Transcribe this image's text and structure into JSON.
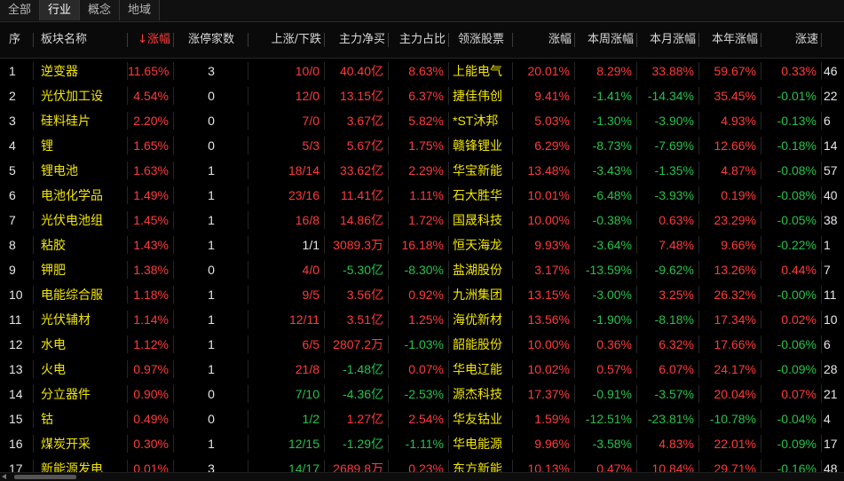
{
  "tabs": [
    "全部",
    "行业",
    "概念",
    "地域"
  ],
  "active_tab": 1,
  "headers": {
    "seq": "序",
    "name": "板块名称",
    "chg": "涨幅",
    "limit": "涨停家数",
    "updown": "上涨/下跌",
    "netbuy": "主力净买",
    "ratio": "主力占比",
    "leader": "领涨股票",
    "lchg": "涨幅",
    "week": "本周涨幅",
    "month": "本月涨幅",
    "year": "本年涨幅",
    "speed": "涨速"
  },
  "sort_arrow": "↓",
  "colors": {
    "up": "#ff3b3b",
    "down": "#27c24c",
    "name": "#f2e600"
  },
  "rows": [
    {
      "seq": "1",
      "name": "逆变器",
      "chg": "11.65%",
      "limit": "3",
      "updown": "10/0",
      "netbuy": "40.40亿",
      "ratio": "8.63%",
      "leader": "上能电气",
      "lchg": "20.01%",
      "week": "8.29%",
      "month": "33.88%",
      "year": "59.67%",
      "speed": "0.33%",
      "extra": "46"
    },
    {
      "seq": "2",
      "name": "光伏加工设",
      "chg": "4.54%",
      "limit": "0",
      "updown": "12/0",
      "netbuy": "13.15亿",
      "ratio": "6.37%",
      "leader": "捷佳伟创",
      "lchg": "9.41%",
      "week": "-1.41%",
      "month": "-14.34%",
      "year": "35.45%",
      "speed": "-0.01%",
      "extra": "22"
    },
    {
      "seq": "3",
      "name": "硅料硅片",
      "chg": "2.20%",
      "limit": "0",
      "updown": "7/0",
      "netbuy": "3.67亿",
      "ratio": "5.82%",
      "leader": "*ST沐邦",
      "lchg": "5.03%",
      "week": "-1.30%",
      "month": "-3.90%",
      "year": "4.93%",
      "speed": "-0.13%",
      "extra": "6"
    },
    {
      "seq": "4",
      "name": "锂",
      "chg": "1.65%",
      "limit": "0",
      "updown": "5/3",
      "netbuy": "5.67亿",
      "ratio": "1.75%",
      "leader": "赣锋锂业",
      "lchg": "6.29%",
      "week": "-8.73%",
      "month": "-7.69%",
      "year": "12.66%",
      "speed": "-0.18%",
      "extra": "14"
    },
    {
      "seq": "5",
      "name": "锂电池",
      "chg": "1.63%",
      "limit": "1",
      "updown": "18/14",
      "netbuy": "33.62亿",
      "ratio": "2.29%",
      "leader": "华宝新能",
      "lchg": "13.48%",
      "week": "-3.43%",
      "month": "-1.35%",
      "year": "4.87%",
      "speed": "-0.08%",
      "extra": "57"
    },
    {
      "seq": "6",
      "name": "电池化学品",
      "chg": "1.49%",
      "limit": "1",
      "updown": "23/16",
      "netbuy": "11.41亿",
      "ratio": "1.11%",
      "leader": "石大胜华",
      "lchg": "10.01%",
      "week": "-6.48%",
      "month": "-3.93%",
      "year": "0.19%",
      "speed": "-0.08%",
      "extra": "40"
    },
    {
      "seq": "7",
      "name": "光伏电池组",
      "chg": "1.45%",
      "limit": "1",
      "updown": "16/8",
      "netbuy": "14.86亿",
      "ratio": "1.72%",
      "leader": "国晟科技",
      "lchg": "10.00%",
      "week": "-0.38%",
      "month": "0.63%",
      "year": "23.29%",
      "speed": "-0.05%",
      "extra": "38"
    },
    {
      "seq": "8",
      "name": "粘胶",
      "chg": "1.43%",
      "limit": "1",
      "updown": "1/1",
      "netbuy": "3089.3万",
      "ratio": "16.18%",
      "leader": "恒天海龙",
      "lchg": "9.93%",
      "week": "-3.64%",
      "month": "7.48%",
      "year": "9.66%",
      "speed": "-0.22%",
      "extra": "1"
    },
    {
      "seq": "9",
      "name": "钾肥",
      "chg": "1.38%",
      "limit": "0",
      "updown": "4/0",
      "netbuy": "-5.30亿",
      "ratio": "-8.30%",
      "leader": "盐湖股份",
      "lchg": "3.17%",
      "week": "-13.59%",
      "month": "-9.62%",
      "year": "13.26%",
      "speed": "0.44%",
      "extra": "7"
    },
    {
      "seq": "10",
      "name": "电能综合服",
      "chg": "1.18%",
      "limit": "1",
      "updown": "9/5",
      "netbuy": "3.56亿",
      "ratio": "0.92%",
      "leader": "九洲集团",
      "lchg": "13.15%",
      "week": "-3.00%",
      "month": "3.25%",
      "year": "26.32%",
      "speed": "-0.00%",
      "extra": "11"
    },
    {
      "seq": "11",
      "name": "光伏辅材",
      "chg": "1.14%",
      "limit": "1",
      "updown": "12/11",
      "netbuy": "3.51亿",
      "ratio": "1.25%",
      "leader": "海优新材",
      "lchg": "13.56%",
      "week": "-1.90%",
      "month": "-8.18%",
      "year": "17.34%",
      "speed": "0.02%",
      "extra": "10"
    },
    {
      "seq": "12",
      "name": "水电",
      "chg": "1.12%",
      "limit": "1",
      "updown": "6/5",
      "netbuy": "2807.2万",
      "ratio": "-1.03%",
      "leader": "韶能股份",
      "lchg": "10.00%",
      "week": "0.36%",
      "month": "6.32%",
      "year": "17.66%",
      "speed": "-0.06%",
      "extra": "6"
    },
    {
      "seq": "13",
      "name": "火电",
      "chg": "0.97%",
      "limit": "1",
      "updown": "21/8",
      "netbuy": "-1.48亿",
      "ratio": "0.07%",
      "leader": "华电辽能",
      "lchg": "10.02%",
      "week": "0.57%",
      "month": "6.07%",
      "year": "24.17%",
      "speed": "-0.09%",
      "extra": "28"
    },
    {
      "seq": "14",
      "name": "分立器件",
      "chg": "0.90%",
      "limit": "0",
      "updown": "7/10",
      "netbuy": "-4.36亿",
      "ratio": "-2.53%",
      "leader": "源杰科技",
      "lchg": "17.37%",
      "week": "-0.91%",
      "month": "-3.57%",
      "year": "20.04%",
      "speed": "0.07%",
      "extra": "21"
    },
    {
      "seq": "15",
      "name": "钴",
      "chg": "0.49%",
      "limit": "0",
      "updown": "1/2",
      "netbuy": "1.27亿",
      "ratio": "2.54%",
      "leader": "华友钴业",
      "lchg": "1.59%",
      "week": "-12.51%",
      "month": "-23.81%",
      "year": "-10.78%",
      "speed": "-0.04%",
      "extra": "4"
    },
    {
      "seq": "16",
      "name": "煤炭开采",
      "chg": "0.30%",
      "limit": "1",
      "updown": "12/15",
      "netbuy": "-1.29亿",
      "ratio": "-1.11%",
      "leader": "华电能源",
      "lchg": "9.96%",
      "week": "-3.58%",
      "month": "4.83%",
      "year": "22.01%",
      "speed": "-0.09%",
      "extra": "17"
    },
    {
      "seq": "17",
      "name": "新能源发电",
      "chg": "0.01%",
      "limit": "3",
      "updown": "14/17",
      "netbuy": "2689.8万",
      "ratio": "0.23%",
      "leader": "东方新能",
      "lchg": "10.13%",
      "week": "0.47%",
      "month": "10.84%",
      "year": "29.71%",
      "speed": "-0.16%",
      "extra": "48"
    }
  ]
}
